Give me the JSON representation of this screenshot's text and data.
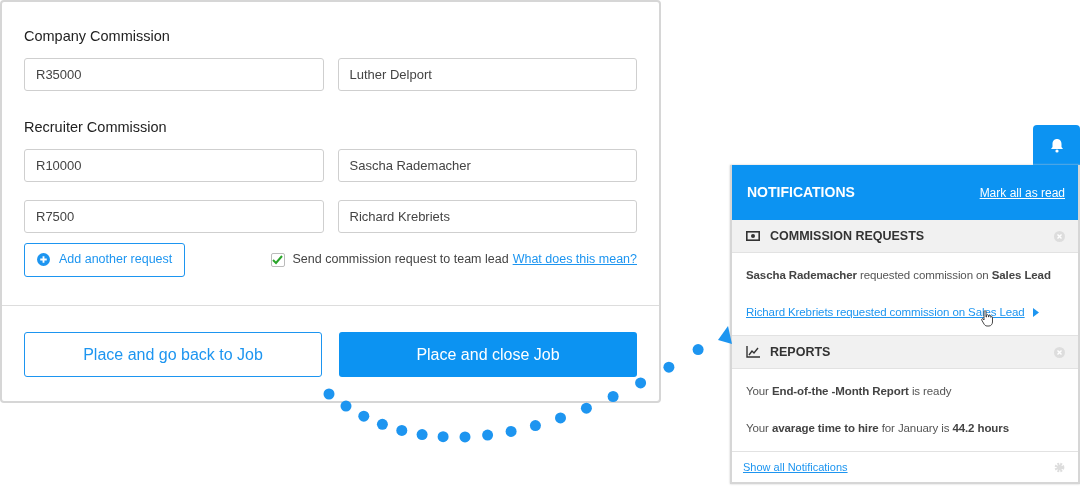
{
  "commission_form": {
    "sections": [
      {
        "heading": "Company Commission",
        "rows": [
          {
            "amount": "R35000",
            "person": "Luther Delport"
          }
        ]
      },
      {
        "heading": "Recruiter Commission",
        "rows": [
          {
            "amount": "R10000",
            "person": "Sascha Rademacher"
          },
          {
            "amount": "R7500",
            "person": "Richard Krebriets"
          }
        ]
      }
    ],
    "add_button": "Add another request",
    "send_to_lead": {
      "label": "Send commission request to team lead",
      "checked": true,
      "help_link": "What does this mean?"
    },
    "buttons": [
      {
        "label": "Place and go back to Job",
        "kind": "outline"
      },
      {
        "label": "Place and close Job",
        "kind": "primary"
      }
    ]
  },
  "notifications": {
    "title": "NOTIFICATIONS",
    "mark_all": "Mark all as read",
    "groups": [
      {
        "title": "COMMISSION REQUESTS",
        "kind": "money",
        "items": [
          {
            "text": "**Sascha Rademacher** requested commission on **Sales Lead**",
            "kind": "text"
          },
          {
            "text": "Richard Krebriets requested commission on Sales Lead",
            "kind": "link"
          }
        ]
      },
      {
        "title": "REPORTS",
        "kind": "chart",
        "items": [
          {
            "text": "Your **End-of-the -Month Report** is ready",
            "kind": "text"
          },
          {
            "text": "Your **avarage time to hire** for January is **44.2 hours**",
            "kind": "text"
          }
        ]
      }
    ],
    "show_all": "Show all Notifications"
  }
}
